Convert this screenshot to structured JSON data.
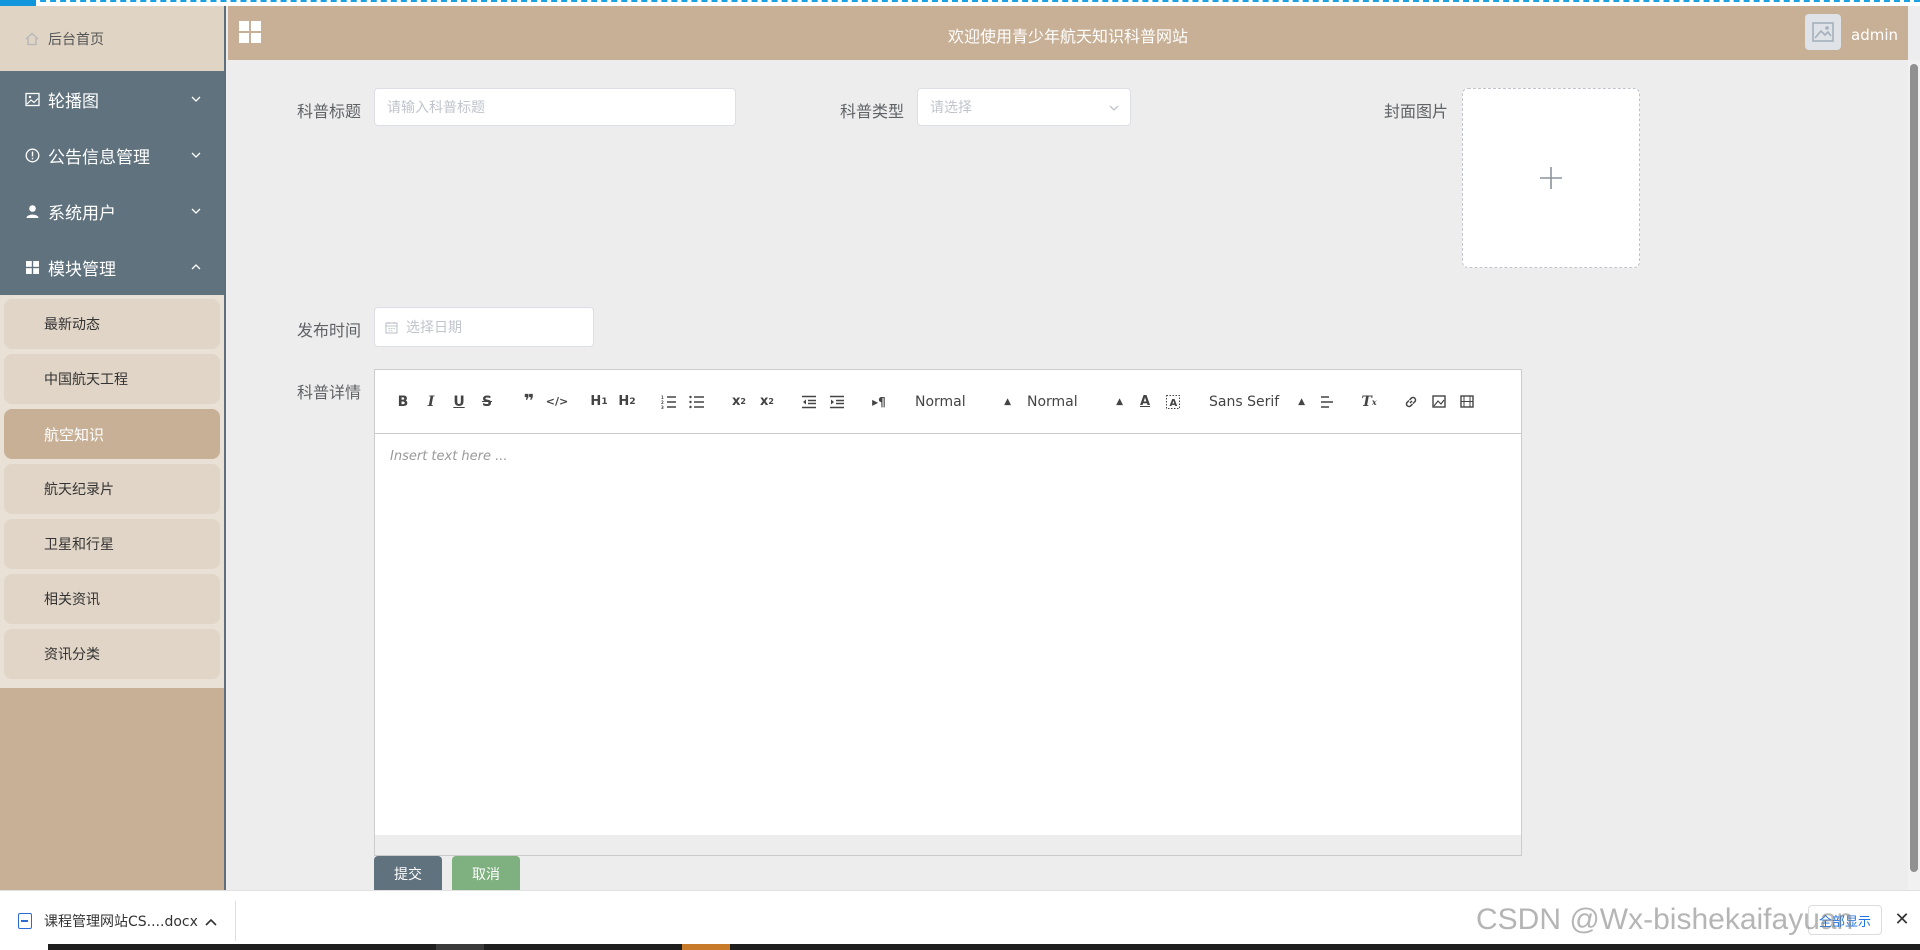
{
  "colors": {
    "sidebar_bg": "#c8b096",
    "menu_bg": "#5f727e",
    "header_bg": "#c8b096",
    "submit_btn": "#5f727e",
    "cancel_btn": "#7fb07f"
  },
  "sidebar": {
    "home_label": "后台首页",
    "menus": [
      {
        "label": "轮播图",
        "icon": "picture-icon"
      },
      {
        "label": "公告信息管理",
        "icon": "info-icon"
      },
      {
        "label": "系统用户",
        "icon": "user-icon"
      },
      {
        "label": "模块管理",
        "icon": "grid-icon"
      }
    ],
    "submenu": [
      {
        "label": "最新动态"
      },
      {
        "label": "中国航天工程"
      },
      {
        "label": "航空知识"
      },
      {
        "label": "航天纪录片"
      },
      {
        "label": "卫星和行星"
      },
      {
        "label": "相关资讯"
      },
      {
        "label": "资讯分类"
      }
    ]
  },
  "header": {
    "title": "欢迎使用青少年航天知识科普网站",
    "username": "admin"
  },
  "form": {
    "title_label": "科普标题",
    "title_placeholder": "请输入科普标题",
    "type_label": "科普类型",
    "type_placeholder": "请选择",
    "cover_label": "封面图片",
    "date_label": "发布时间",
    "date_placeholder": "选择日期",
    "detail_label": "科普详情"
  },
  "editor": {
    "header_select": "Normal",
    "size_select": "Normal",
    "font_select": "Sans Serif",
    "placeholder": "Insert text here ..."
  },
  "buttons": {
    "submit": "提交",
    "cancel": "取消"
  },
  "download_bar": {
    "file_name": "课程管理网站CS....docx",
    "show_all": "全部显示",
    "watermark": "CSDN @Wx-bishekaifayuan"
  }
}
